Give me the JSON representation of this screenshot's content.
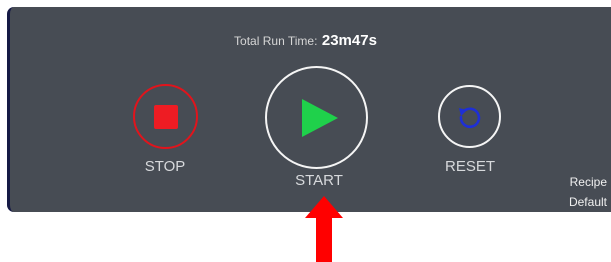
{
  "runtime": {
    "label": "Total Run Time:",
    "value": "23m47s"
  },
  "controls": {
    "stop_label": "STOP",
    "start_label": "START",
    "reset_label": "RESET"
  },
  "recipe": {
    "label": "Recipe",
    "value": "Default"
  },
  "colors": {
    "panel": "#474c54",
    "stop": "#ee1c23",
    "start": "#1fd14b",
    "reset": "#1e2fd6",
    "annotation_arrow": "#ff0000"
  },
  "icons": {
    "stop": "stop-square-icon",
    "start": "play-triangle-icon",
    "reset": "circular-arrow-icon",
    "annotation": "up-arrow-icon"
  }
}
